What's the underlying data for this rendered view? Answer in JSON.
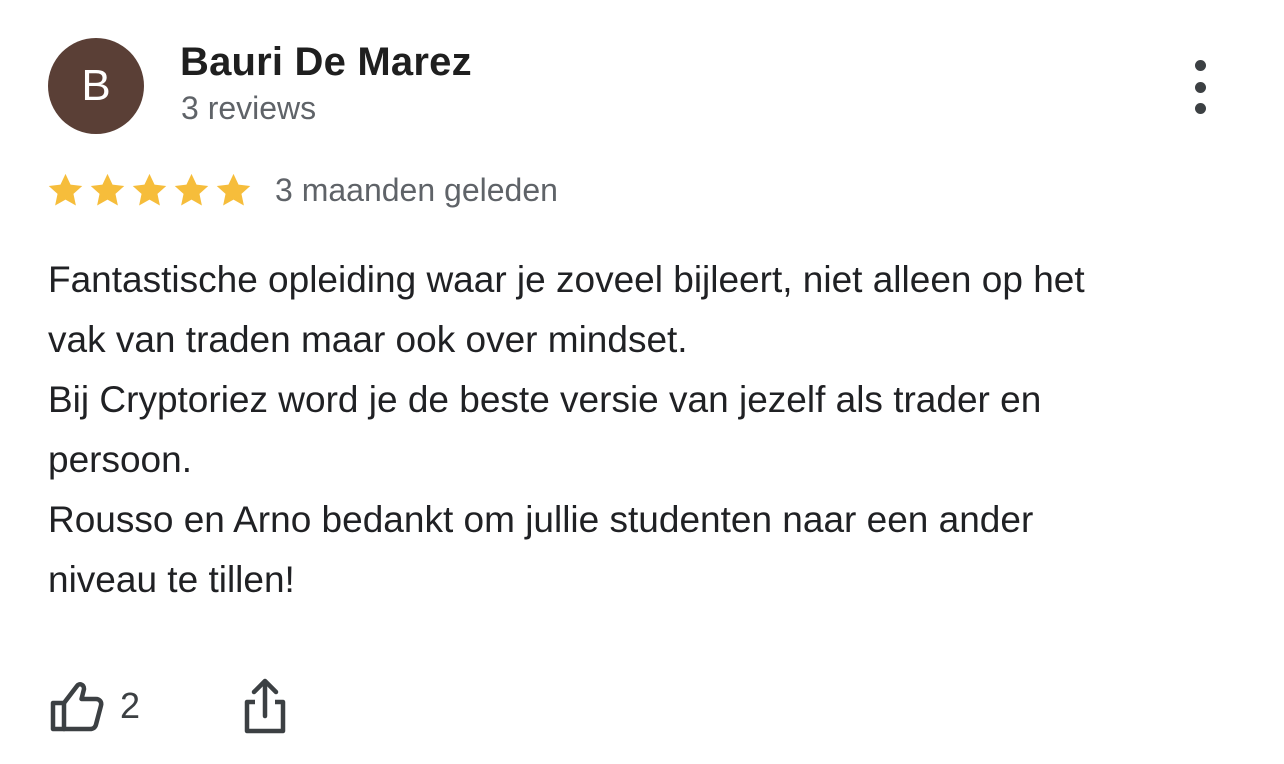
{
  "author": {
    "initial": "B",
    "name": "Bauri De Marez",
    "reviews": "3 reviews",
    "avatar_color": "#5a3f36"
  },
  "review": {
    "rating": 5,
    "max_rating": 5,
    "date": "3 maanden geleden",
    "lines": [
      "Fantastische opleiding waar je zoveel bijleert, niet alleen op het",
      "vak van traden maar ook over mindset.",
      "Bij Cryptoriez word je de beste versie van jezelf als trader en",
      "persoon.",
      "Rousso en Arno bedankt om jullie studenten naar een ander",
      "niveau te tillen!"
    ]
  },
  "actions": {
    "like_count": "2",
    "like_icon": "thumbs-up-icon",
    "share_icon": "share-icon",
    "more_icon": "more-vertical-icon"
  },
  "colors": {
    "star": "#f6bd3b",
    "avatar": "#5a3f36",
    "secondary_text": "#5f6368",
    "icon": "#3c4043"
  }
}
